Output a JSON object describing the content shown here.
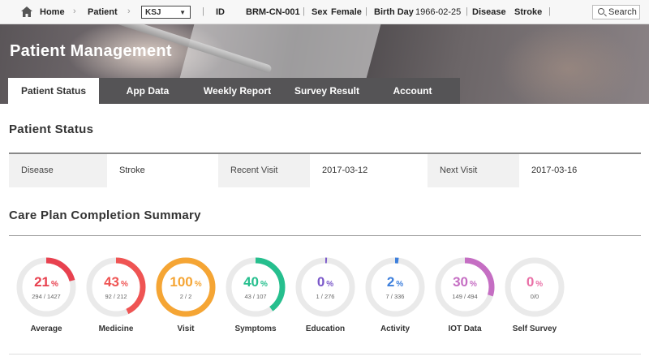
{
  "topbar": {
    "home": "Home",
    "patient_label": "Patient",
    "patient_select": "KSJ",
    "id_label": "ID",
    "id_value": "BRM-CN-001",
    "sex_label": "Sex",
    "sex_value": "Female",
    "birth_label": "Birth Day",
    "birth_value": "1966-02-25",
    "disease_label": "Disease",
    "disease_value": "Stroke",
    "search": "Search"
  },
  "hero": {
    "title": "Patient Management"
  },
  "tabs": [
    "Patient Status",
    "App Data",
    "Weekly Report",
    "Survey Result",
    "Account"
  ],
  "patient_status": {
    "title": "Patient Status",
    "disease_label": "Disease",
    "disease_value": "Stroke",
    "recent_label": "Recent Visit",
    "recent_value": "2017-03-12",
    "next_label": "Next Visit",
    "next_value": "2017-03-16"
  },
  "summary": {
    "title": "Care Plan Completion Summary",
    "unit": "%",
    "gauges": [
      {
        "label": "Average",
        "percent": "21",
        "ratio": "294 / 1427",
        "fraction": 0.21,
        "color": "#e8414f"
      },
      {
        "label": "Medicine",
        "percent": "43",
        "ratio": "92 / 212",
        "fraction": 0.43,
        "color": "#ef5453"
      },
      {
        "label": "Visit",
        "percent": "100",
        "ratio": "2 / 2",
        "fraction": 1.0,
        "color": "#f5a534"
      },
      {
        "label": "Symptoms",
        "percent": "40",
        "ratio": "43 / 107",
        "fraction": 0.4,
        "color": "#26bf8e"
      },
      {
        "label": "Education",
        "percent": "0",
        "ratio": "1 / 276",
        "fraction": 0.004,
        "color": "#7a58c9"
      },
      {
        "label": "Activity",
        "percent": "2",
        "ratio": "7 / 336",
        "fraction": 0.02,
        "color": "#3d7fdc"
      },
      {
        "label": "IOT Data",
        "percent": "30",
        "ratio": "149 / 494",
        "fraction": 0.3,
        "color": "#c56ec3"
      },
      {
        "label": "Self Survey",
        "percent": "0",
        "ratio": "0/0",
        "fraction": 0.0,
        "color": "#e96fa6"
      }
    ]
  },
  "colors": {
    "track": "#eaeaea",
    "tabbar": "#555456"
  }
}
